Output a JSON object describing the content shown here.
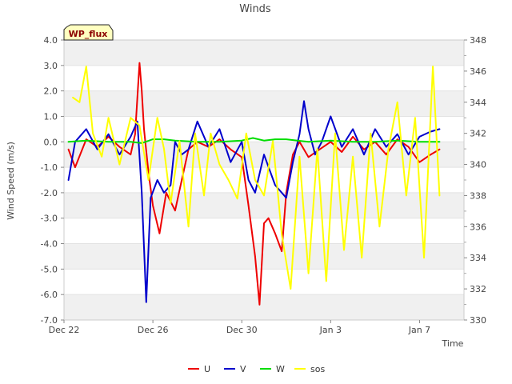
{
  "chart_data": {
    "type": "line",
    "title": "Winds",
    "xlabel": "Time",
    "ylabel": "Wind Speed (m/s)",
    "ylim": [
      -7.0,
      4.0
    ],
    "y2lim": [
      330,
      348
    ],
    "xlim": [
      0,
      18
    ],
    "x_ticks": [
      {
        "value": 0,
        "label": "Dec 22"
      },
      {
        "value": 4,
        "label": "Dec 26"
      },
      {
        "value": 8,
        "label": "Dec 30"
      },
      {
        "value": 12,
        "label": "Jan 3"
      },
      {
        "value": 16,
        "label": "Jan 7"
      }
    ],
    "y_ticks": [
      "-7.0",
      "-6.0",
      "-5.0",
      "-4.0",
      "-3.0",
      "-2.0",
      "-1.0",
      "0.0",
      "1.0",
      "2.0",
      "3.0",
      "4.0"
    ],
    "y2_ticks": [
      "330",
      "332",
      "334",
      "336",
      "338",
      "340",
      "342",
      "344",
      "346",
      "348"
    ],
    "grid": "horizontal bands",
    "legend_position": "bottom",
    "annotation": "WP_flux",
    "series": [
      {
        "name": "U",
        "color": "#ee0000",
        "axis": "left",
        "x": [
          0.2,
          0.5,
          1.0,
          1.5,
          2.0,
          2.5,
          3.0,
          3.2,
          3.4,
          3.5,
          3.6,
          3.8,
          4.0,
          4.3,
          4.6,
          5.0,
          5.3,
          5.6,
          6.0,
          6.5,
          7.0,
          7.5,
          8.0,
          8.3,
          8.6,
          8.8,
          9.0,
          9.2,
          9.5,
          9.8,
          10.0,
          10.3,
          10.6,
          11.0,
          11.5,
          12.0,
          12.5,
          13.0,
          13.5,
          14.0,
          14.5,
          15.0,
          15.5,
          16.0,
          16.5,
          16.9
        ],
        "values": [
          -0.3,
          -1.0,
          0.1,
          -0.2,
          0.2,
          -0.2,
          -0.5,
          0.3,
          3.1,
          2.0,
          0.5,
          -1.2,
          -2.5,
          -3.6,
          -2.0,
          -2.7,
          -1.5,
          -0.3,
          0.0,
          -0.2,
          0.1,
          -0.3,
          -0.6,
          -2.5,
          -4.5,
          -6.4,
          -3.2,
          -3.0,
          -3.6,
          -4.3,
          -2.0,
          -0.5,
          0.0,
          -0.6,
          -0.3,
          0.0,
          -0.4,
          0.2,
          -0.3,
          0.0,
          -0.5,
          0.1,
          -0.2,
          -0.8,
          -0.5,
          -0.3
        ]
      },
      {
        "name": "V",
        "color": "#0000cc",
        "axis": "left",
        "x": [
          0.2,
          0.5,
          1.0,
          1.5,
          2.0,
          2.5,
          3.0,
          3.3,
          3.5,
          3.7,
          3.9,
          4.2,
          4.5,
          4.8,
          5.0,
          5.3,
          5.6,
          6.0,
          6.5,
          7.0,
          7.5,
          8.0,
          8.3,
          8.6,
          9.0,
          9.5,
          10.0,
          10.3,
          10.6,
          10.8,
          11.0,
          11.3,
          11.6,
          12.0,
          12.5,
          13.0,
          13.5,
          14.0,
          14.5,
          15.0,
          15.5,
          16.0,
          16.5,
          16.9
        ],
        "values": [
          -1.5,
          0.0,
          0.5,
          -0.3,
          0.3,
          -0.5,
          0.2,
          0.8,
          -2.0,
          -6.3,
          -2.2,
          -1.5,
          -2.0,
          -1.7,
          0.0,
          -0.5,
          -0.3,
          0.8,
          -0.2,
          0.5,
          -0.8,
          0.0,
          -1.5,
          -2.0,
          -0.5,
          -1.7,
          -2.2,
          -0.8,
          0.3,
          1.6,
          0.5,
          -0.5,
          0.0,
          1.0,
          -0.2,
          0.5,
          -0.5,
          0.5,
          -0.2,
          0.3,
          -0.5,
          0.2,
          0.4,
          0.5
        ]
      },
      {
        "name": "W",
        "color": "#00dd00",
        "axis": "left",
        "x": [
          0.2,
          1.0,
          2.0,
          3.0,
          3.5,
          4.0,
          4.5,
          5.0,
          6.0,
          7.0,
          8.0,
          8.5,
          9.0,
          9.5,
          10.0,
          10.5,
          11.0,
          12.0,
          13.0,
          14.0,
          15.0,
          16.0,
          16.9
        ],
        "values": [
          0.0,
          0.05,
          0.0,
          0.0,
          -0.05,
          0.1,
          0.1,
          0.05,
          0.0,
          0.0,
          0.05,
          0.15,
          0.05,
          0.1,
          0.1,
          0.05,
          0.0,
          0.05,
          0.0,
          0.0,
          0.05,
          0.0,
          0.0
        ]
      },
      {
        "name": "sos",
        "color": "#ffff00",
        "axis": "right",
        "x": [
          0.4,
          0.7,
          1.0,
          1.3,
          1.7,
          2.0,
          2.5,
          3.0,
          3.4,
          3.8,
          4.2,
          4.5,
          4.8,
          5.2,
          5.6,
          5.9,
          6.3,
          6.6,
          7.0,
          7.4,
          7.8,
          8.2,
          8.6,
          9.0,
          9.4,
          9.8,
          10.2,
          10.6,
          11.0,
          11.4,
          11.8,
          12.2,
          12.6,
          13.0,
          13.4,
          13.8,
          14.2,
          14.6,
          15.0,
          15.4,
          15.8,
          16.2,
          16.6,
          16.9
        ],
        "values": [
          344.3,
          344.0,
          346.3,
          342.0,
          340.5,
          343.0,
          340.0,
          343.0,
          342.5,
          339.0,
          343.0,
          341.0,
          337.5,
          341.5,
          336.0,
          342.0,
          338.0,
          342.0,
          340.0,
          339.0,
          337.8,
          342.0,
          339.0,
          338.0,
          341.5,
          335.5,
          332.0,
          340.5,
          333.0,
          341.0,
          332.5,
          342.0,
          334.5,
          340.5,
          334.0,
          342.0,
          336.0,
          341.0,
          344.0,
          338.0,
          343.0,
          334.0,
          346.3,
          338.0
        ]
      }
    ]
  }
}
